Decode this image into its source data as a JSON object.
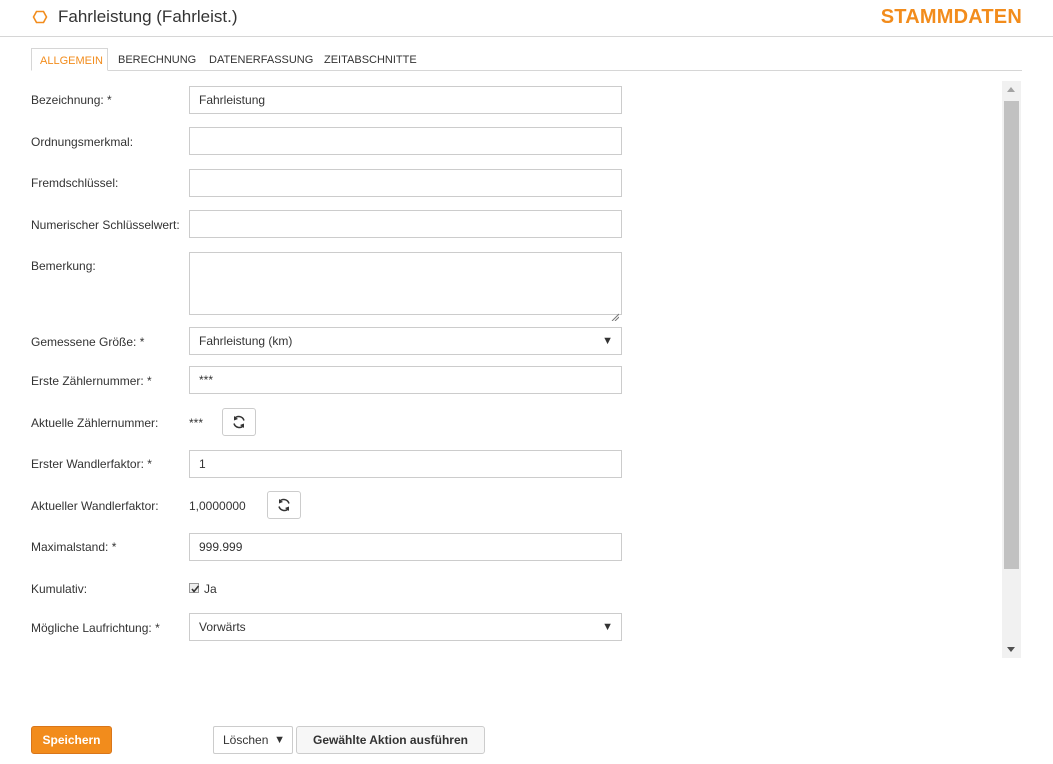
{
  "header": {
    "title": "Fahrleistung (Fahrleist.)",
    "brand": "STAMMDATEN",
    "accent_color": "#f28c1c",
    "icon": "hexagon-icon"
  },
  "tabs": [
    {
      "label": "ALLGEMEIN",
      "active": true
    },
    {
      "label": "BERECHNUNG",
      "active": false
    },
    {
      "label": "DATENERFASSUNG",
      "active": false
    },
    {
      "label": "ZEITABSCHNITTE",
      "active": false
    }
  ],
  "form": {
    "bezeichnung": {
      "label": "Bezeichnung: *",
      "value": "Fahrleistung"
    },
    "ordnungsmerkmal": {
      "label": "Ordnungsmerkmal:",
      "value": ""
    },
    "fremdschluessel": {
      "label": "Fremdschlüssel:",
      "value": ""
    },
    "num_schluessel": {
      "label": "Numerischer Schlüsselwert:",
      "value": ""
    },
    "bemerkung": {
      "label": "Bemerkung:",
      "value": ""
    },
    "gemessene_groesse": {
      "label": "Gemessene Größe: *",
      "value": "Fahrleistung (km)"
    },
    "erste_zaehlernummer": {
      "label": "Erste Zählernummer: *",
      "value": "***"
    },
    "aktuelle_zaehlernummer": {
      "label": "Aktuelle Zählernummer:",
      "value": "***"
    },
    "erster_wandlerfaktor": {
      "label": "Erster Wandlerfaktor: *",
      "value": "1"
    },
    "aktueller_wandlerfaktor": {
      "label": "Aktueller Wandlerfaktor:",
      "value": "1,0000000"
    },
    "maximalstand": {
      "label": "Maximalstand: *",
      "value": "999.999"
    },
    "kumulativ": {
      "label": "Kumulativ:",
      "checkbox_label": "Ja",
      "checked": true
    },
    "laufrichtung": {
      "label": "Mögliche Laufrichtung: *",
      "value": "Vorwärts"
    }
  },
  "footer": {
    "save_label": "Speichern",
    "action_select": "Löschen",
    "execute_label": "Gewählte Aktion ausführen"
  }
}
